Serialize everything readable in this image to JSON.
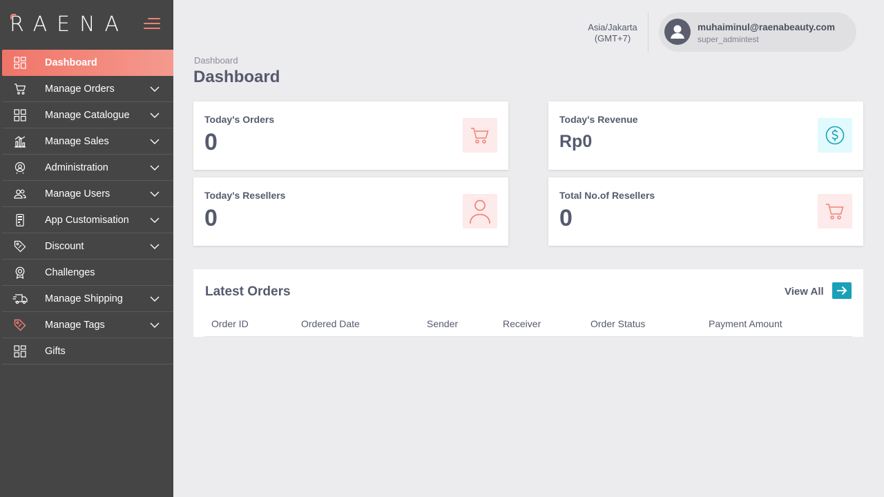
{
  "brand": {
    "name": "RAENA",
    "accent": "#f28074",
    "sidebar_bg": "#454545"
  },
  "sidebar": {
    "items": [
      {
        "label": "Dashboard",
        "icon": "grid-icon",
        "active": true,
        "expandable": false
      },
      {
        "label": "Manage Orders",
        "icon": "cart-icon",
        "expandable": true
      },
      {
        "label": "Manage Catalogue",
        "icon": "grid-icon",
        "expandable": true
      },
      {
        "label": "Manage Sales",
        "icon": "bar-chart-icon",
        "expandable": true
      },
      {
        "label": "Administration",
        "icon": "admin-icon",
        "expandable": true
      },
      {
        "label": "Manage Users",
        "icon": "users-icon",
        "expandable": true
      },
      {
        "label": "App Customisation",
        "icon": "mobile-icon",
        "expandable": true
      },
      {
        "label": "Discount",
        "icon": "tag-icon",
        "expandable": true
      },
      {
        "label": "Challenges",
        "icon": "badge-icon",
        "expandable": false
      },
      {
        "label": "Manage Shipping",
        "icon": "truck-icon",
        "expandable": true
      },
      {
        "label": "Manage Tags",
        "icon": "tag-accent-icon",
        "expandable": true
      },
      {
        "label": "Gifts",
        "icon": "grid-icon",
        "expandable": false
      }
    ]
  },
  "header": {
    "timezone_line1": "Asia/Jakarta",
    "timezone_line2": "(GMT+7)",
    "user_email": "muhaiminul@raenabeauty.com",
    "user_role": "super_admintest"
  },
  "page": {
    "breadcrumb": "Dashboard",
    "title": "Dashboard"
  },
  "stats": {
    "today_orders": {
      "label": "Today's Orders",
      "value": "0",
      "icon": "cart-icon"
    },
    "today_revenue": {
      "label": "Today's Revenue",
      "value": "Rp0",
      "icon": "dollar-circle-icon"
    },
    "today_resellers": {
      "label": "Today's Resellers",
      "value": "0",
      "icon": "user-icon"
    },
    "total_resellers": {
      "label": "Total No.of Resellers",
      "value": "0",
      "icon": "cart-icon"
    }
  },
  "latest_orders": {
    "title": "Latest Orders",
    "view_all": "View All",
    "columns": [
      "Order ID",
      "Ordered Date",
      "Sender",
      "Receiver",
      "Order Status",
      "Payment Amount"
    ]
  }
}
